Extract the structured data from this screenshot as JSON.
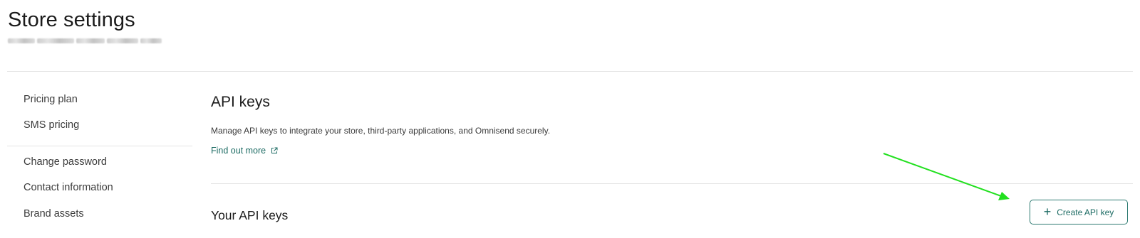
{
  "page": {
    "title": "Store settings"
  },
  "sidebar": {
    "items": [
      {
        "label": "Pricing plan"
      },
      {
        "label": "SMS pricing"
      },
      {
        "label": "Change password"
      },
      {
        "label": "Contact information"
      },
      {
        "label": "Brand assets"
      }
    ]
  },
  "main": {
    "section_title": "API keys",
    "description": "Manage API keys to integrate your store, third-party applications, and Omnisend securely.",
    "find_out_more_label": "Find out more",
    "find_out_more_icon": "external-link-icon",
    "your_keys_title": "Your API keys",
    "create_button_label": "Create API key",
    "create_button_icon": "plus-icon"
  },
  "colors": {
    "accent": "#1c6b63",
    "annotation_arrow": "#22e01f",
    "divider": "#e4e4e4"
  }
}
